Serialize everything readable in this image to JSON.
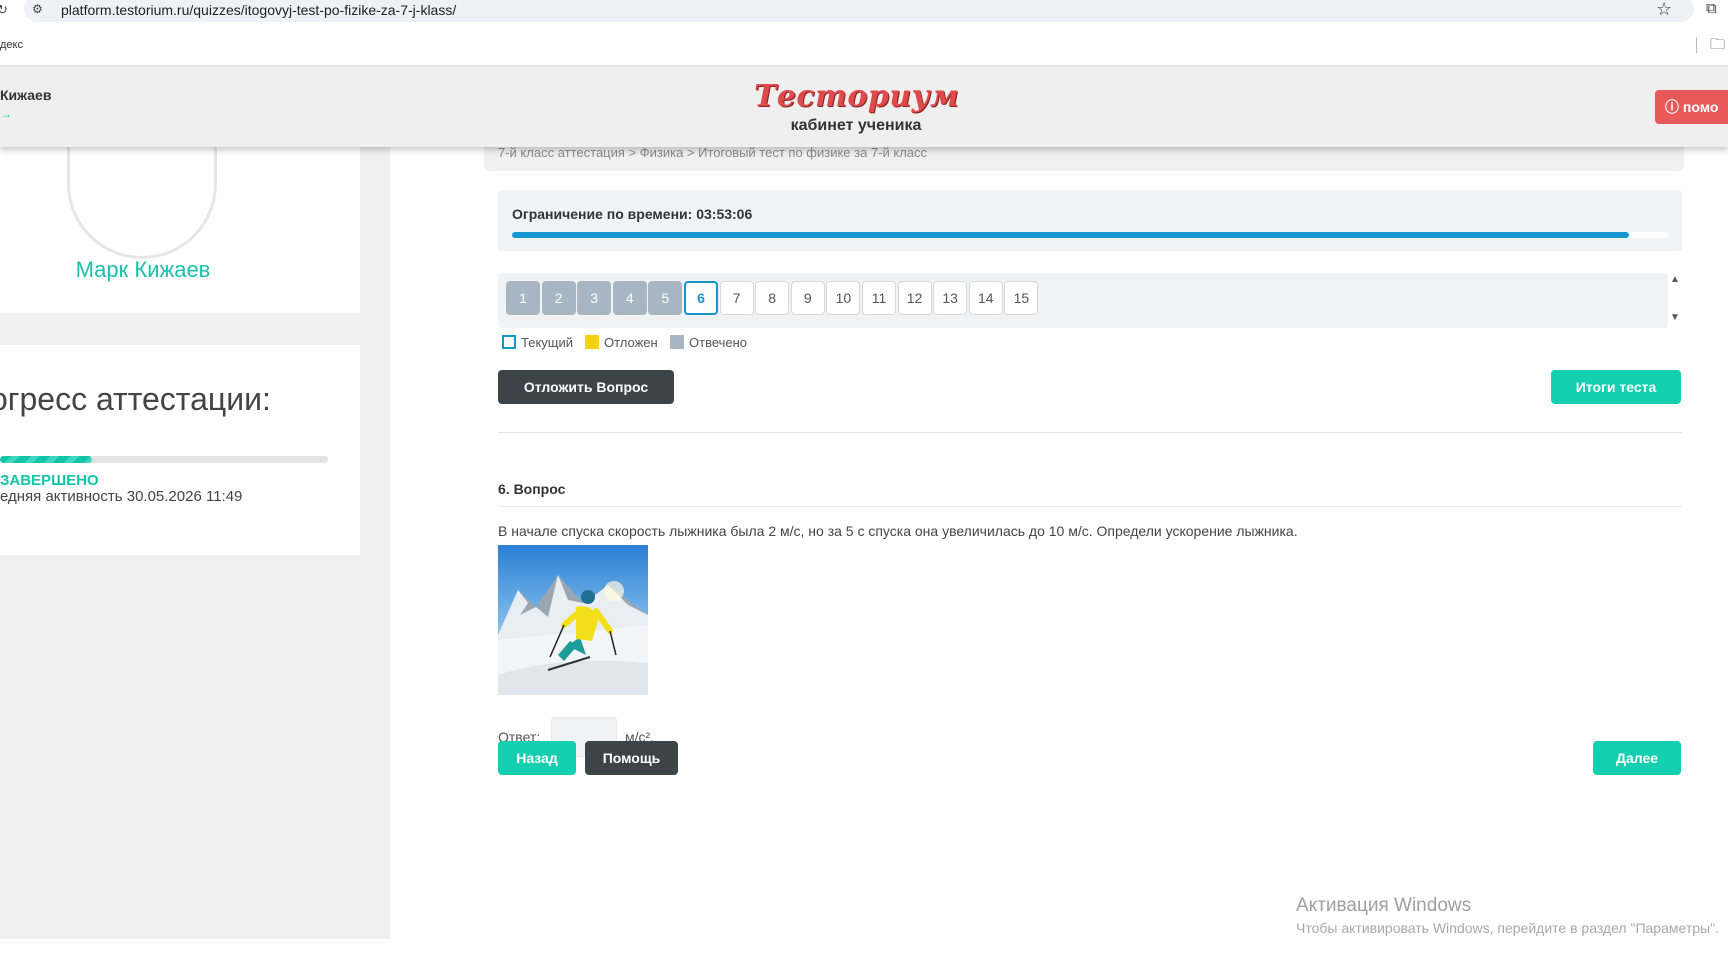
{
  "browser": {
    "url": "platform.testorium.ru/quizzes/itogovyj-test-po-fizike-za-7-j-klass/",
    "bookmark_left": "декс"
  },
  "header": {
    "user_short": "Кижаев",
    "logout_arrow": "→",
    "logo": "Тесториум",
    "logo_sub": "кабинет ученика",
    "help_label": "помо"
  },
  "sidebar": {
    "profile_name": "Марк Кижаев",
    "progress_title": "огресс аттестации:",
    "progress_fraction": 0.28,
    "status": "ЗАВЕРШЕНО",
    "activity": "едняя активность 30.05.2026 11:49"
  },
  "main": {
    "breadcrumb": "7-й класс аттестация > Физика > Итоговый тест по физике за 7-й класс",
    "timer": {
      "label": "Ограничение по времени:",
      "value": "03:53:06",
      "fraction": 0.966
    },
    "questions": [
      {
        "n": "1",
        "state": "answered"
      },
      {
        "n": "2",
        "state": "answered"
      },
      {
        "n": "3",
        "state": "answered"
      },
      {
        "n": "4",
        "state": "answered"
      },
      {
        "n": "5",
        "state": "answered"
      },
      {
        "n": "6",
        "state": "current"
      },
      {
        "n": "7",
        "state": "none"
      },
      {
        "n": "8",
        "state": "none"
      },
      {
        "n": "9",
        "state": "none"
      },
      {
        "n": "10",
        "state": "none"
      },
      {
        "n": "11",
        "state": "none"
      },
      {
        "n": "12",
        "state": "none"
      },
      {
        "n": "13",
        "state": "none"
      },
      {
        "n": "14",
        "state": "none"
      },
      {
        "n": "15",
        "state": "none"
      }
    ],
    "legend": {
      "current": "Текущий",
      "deferred": "Отложен",
      "answered": "Отвечено"
    },
    "defer_button": "Отложить Вопрос",
    "results_button": "Итоги теста",
    "question_title": "6. Вопрос",
    "question_text": "В начале спуска скорость лыжника была 2 м/с, но за 5 с спуска она увеличилась до 10 м/с. Определи ускорение лыжника.",
    "answer_label": "Ответ:",
    "answer_value": "",
    "answer_unit": "м/с².",
    "back_button": "Назад",
    "help_button": "Помощь",
    "next_button": "Далее"
  },
  "watermark": {
    "title": "Активация Windows",
    "subtitle": "Чтобы активировать Windows, перейдите в раздел \"Параметры\"."
  },
  "colors": {
    "accent": "#14cfb0",
    "timer": "#1596d1",
    "answered": "#a8b5c2",
    "deferred": "#f5d10f",
    "logo": "#e04a4a",
    "dark_button": "#3d4448"
  }
}
